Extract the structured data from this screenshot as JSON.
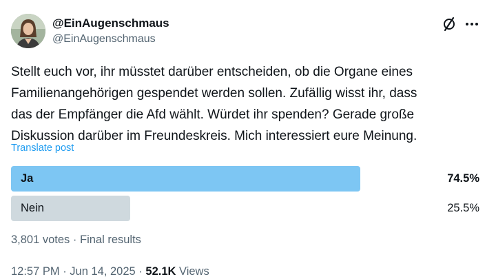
{
  "author": {
    "display_name": "@EinAugenschmaus",
    "handle": "@EinAugenschmaus"
  },
  "icons": {
    "grok": "grok-icon",
    "more": "more-icon",
    "avatar": "avatar"
  },
  "tweet": {
    "text": "Stellt euch vor, ihr müsstet darüber entscheiden, ob die Organe eines\nFamilienangehörigen gespendet werden sollen. Zufällig wisst ihr, dass\ndas der Empfänger die Afd wählt. Würdet ihr spenden? Gerade große\nDiskussion darüber im Freundeskreis. Mich interessiert eure Meinung.",
    "translate_label": "Translate post"
  },
  "poll": {
    "options": [
      {
        "label": "Ja",
        "percent_text": "74.5%",
        "fraction": 0.745,
        "winner": true
      },
      {
        "label": "Nein",
        "percent_text": "25.5%",
        "fraction": 0.255,
        "winner": false
      }
    ],
    "votes": "3,801 votes",
    "separator": " · ",
    "status": "Final results"
  },
  "meta": {
    "time": "12:57 PM",
    "separator": " · ",
    "date": "Jun 14, 2025",
    "views_count": "52.1K",
    "views_label": " Views"
  },
  "colors": {
    "accent": "#1d9bf0",
    "winner_bar": "#7dc6f3",
    "other_bar": "#cfd9de",
    "secondary_text": "#536471"
  }
}
